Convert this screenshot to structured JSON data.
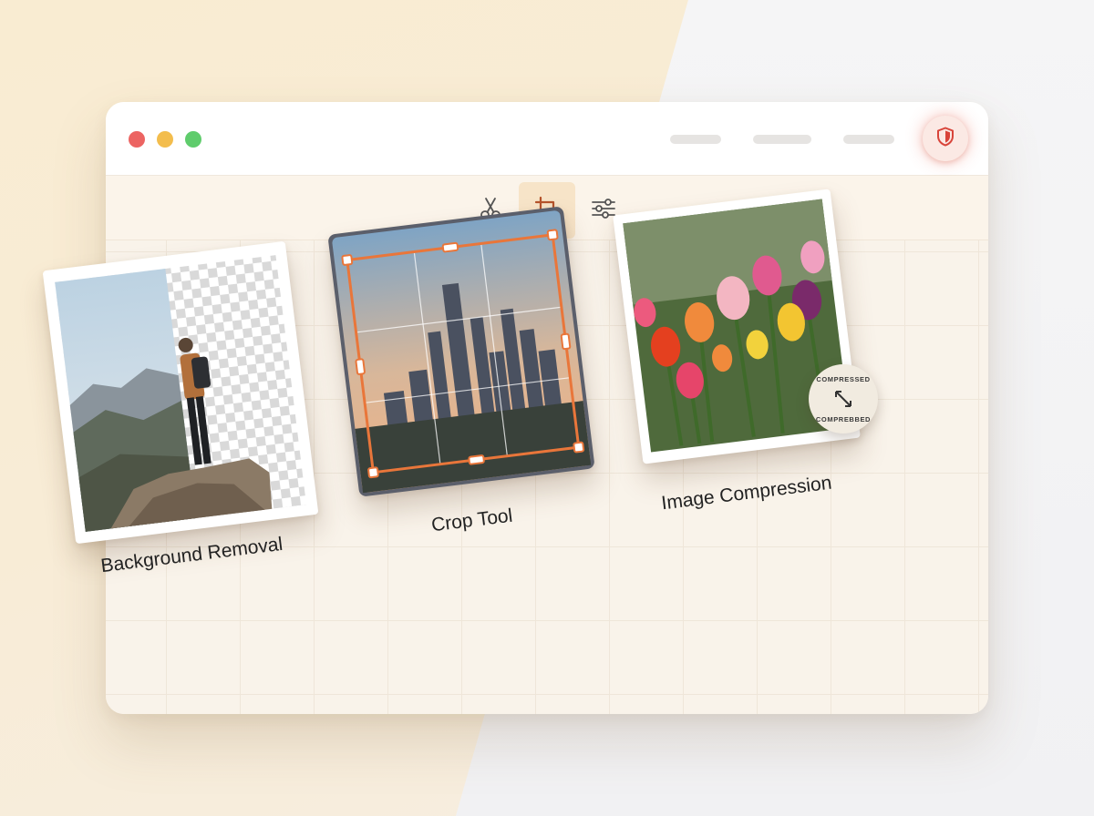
{
  "window": {
    "traffic_lights": [
      "close",
      "minimize",
      "maximize"
    ],
    "header_pills": 3,
    "security_icon": "shield-icon",
    "accent": "#e8573f"
  },
  "toolbar": {
    "tools": [
      {
        "name": "cut",
        "icon": "scissors-icon",
        "active": false
      },
      {
        "name": "crop",
        "icon": "crop-icon",
        "active": true
      },
      {
        "name": "adjust",
        "icon": "sliders-icon",
        "active": false
      }
    ],
    "active_bg": "#f7e4c8"
  },
  "cards": [
    {
      "label": "Background Removal",
      "image": "hiker on rocky summit with checkerboard transparency"
    },
    {
      "label": "Crop Tool",
      "image": "city skyline at sunset with crop handles",
      "crop_accent": "#e9763a"
    },
    {
      "label": "Image Compression",
      "image": "colorful tulips",
      "badge": {
        "top": "COMPRESSED",
        "bottom": "COMPREBBED",
        "icon": "arrows-diagonal-icon"
      }
    }
  ]
}
